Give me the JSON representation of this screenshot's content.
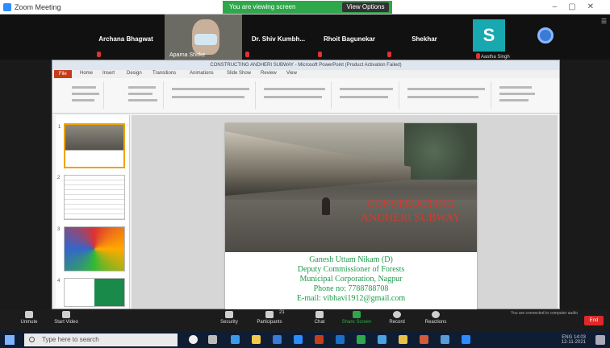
{
  "window": {
    "title": "Zoom Meeting"
  },
  "share_banner": {
    "text": "You are viewing screen",
    "stop_label": "View Options"
  },
  "participants": [
    {
      "name": "Archana Bhagwat",
      "video": false
    },
    {
      "name": "",
      "video": true,
      "label": "Aparna Shirke"
    },
    {
      "name": "Dr. Shiv Kumbh...",
      "video": false
    },
    {
      "name": "Rhoit Bagunekar",
      "video": false
    },
    {
      "name": "Shekhar",
      "video": false
    },
    {
      "name": "S",
      "video": false,
      "avatar_letter": "S",
      "avatar_color": "#18a8b0"
    },
    {
      "name": "",
      "video": false,
      "label": "Aastha Singh"
    }
  ],
  "ppt": {
    "window_title": "CONSTRUCTING ANDHERI SUBWAY - Microsoft PowerPoint (Product Activation Failed)",
    "tabs": [
      "File",
      "Home",
      "Insert",
      "Design",
      "Transitions",
      "Animations",
      "Slide Show",
      "Review",
      "View"
    ],
    "slide_title": "CONSTRUCTING ANDHERI SUBWAY",
    "info_lines": [
      "Ganesh Uttam Nikam (D)",
      "Deputy Commissioner of Forests",
      "Municipal Corporation, Nagpur",
      "Phone no: 7788788708",
      "E-mail: vibhavi1912@gmail.com"
    ]
  },
  "toolbar": {
    "buttons": [
      "Unmute",
      "Start Video",
      "Security",
      "Participants",
      "Chat",
      "Share Screen",
      "Record",
      "Reactions"
    ],
    "participant_count": "21",
    "end_label": "End",
    "recording_note": "You are connected to computer audio"
  },
  "taskbar": {
    "search_placeholder": "Type here to search",
    "time": "14:03",
    "date": "12-11-2021",
    "lang": "ENG"
  },
  "colors": {
    "share_green": "#2ea84a",
    "title_red": "#d23b2f",
    "info_green": "#1d9a4a",
    "zoom_dark": "#111111"
  }
}
